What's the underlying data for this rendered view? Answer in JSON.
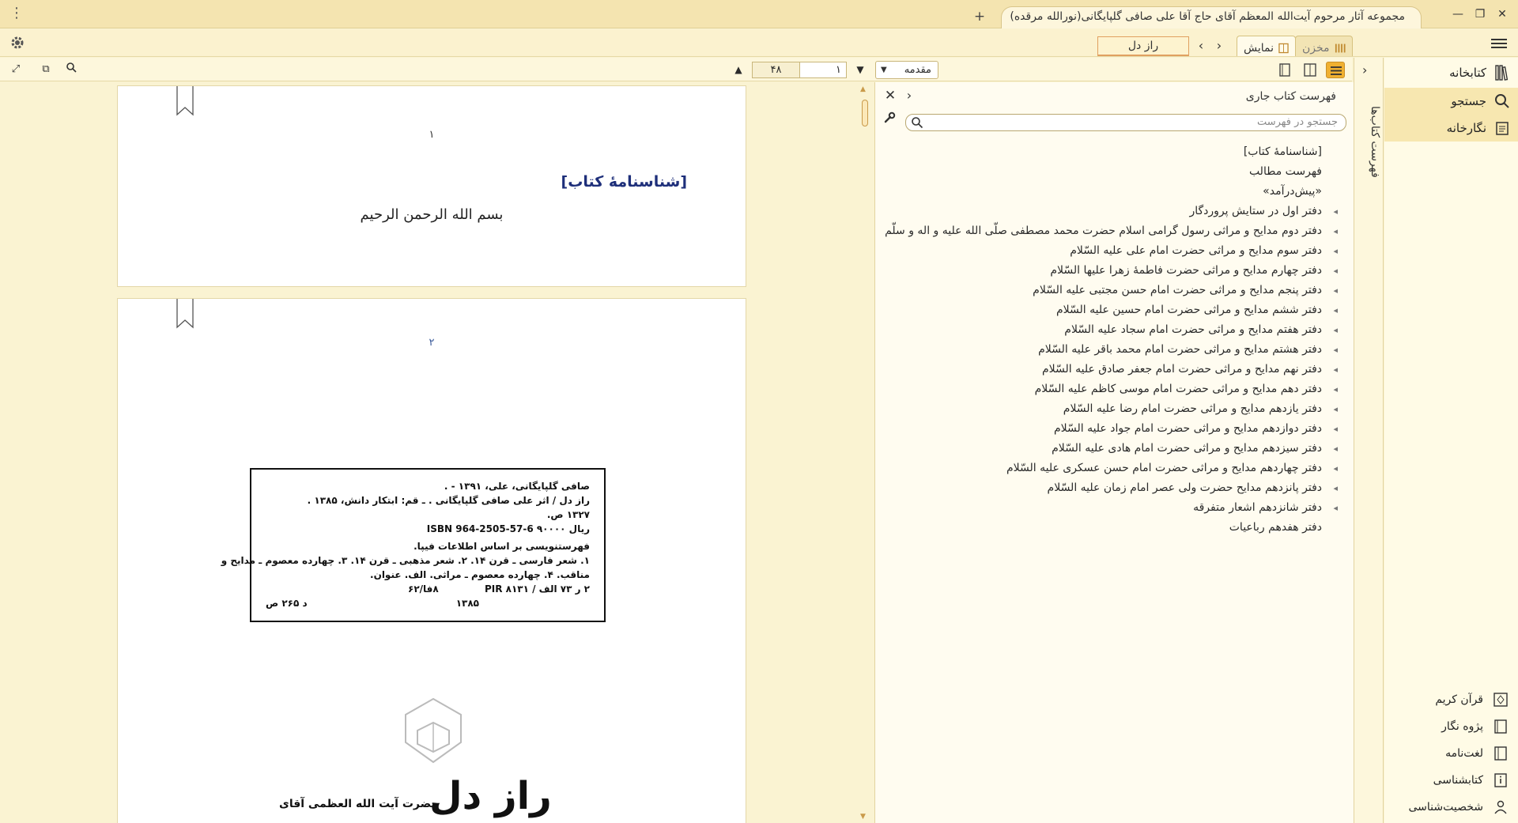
{
  "window": {
    "title": "مجموعه آثار مرحوم آیت‌الله المعظم آقای حاج آقا علی صافی گلپایگانی(نورالله مرقده)",
    "menu_dots": "⋮",
    "new_tab": "+",
    "minimize": "—",
    "restore": "❐",
    "close": "✕"
  },
  "top_tabs": {
    "makhzan": "مخزن",
    "namayesh": "نمایش",
    "book_tab": "راز دل"
  },
  "viewer_toolbar": {
    "section": "مقدمه",
    "page_current": "۱",
    "page_total": "۴۸"
  },
  "pages": {
    "page1": {
      "number": "۱",
      "heading": "[شناسنامهٔ کتاب]",
      "basmala": "بسم الله الرحمن الرحیم"
    },
    "page2": {
      "number": "۲",
      "catalog": {
        "line1": "صافی گلپایگانی، علی، ۱۳۹۱ - .",
        "line2": "راز دل / اثر علی صافی گلپایگانی . ـ قم: ابتکار دانش، ۱۳۸۵ .",
        "line3": "۱۳۲۷ ص.",
        "isbn": "ISBN 964-2505-57-6 ۹۰۰۰۰ ریال",
        "line5": "فهرستنویسی بر اساس اطلاعات فیپا.",
        "line6": "۱. شعر فارسی ـ قرن ۱۴. ۲. شعر مذهبی ـ قرن ۱۴. ۳. چهارده معصوم ـ مدایح و",
        "line7": "مناقب. ۴. چهارده معصوم ـ مراثی. الف. عنوان.",
        "line8_a": "۲ ر ۷۳ الف / ۸۱۳۱ PIR",
        "line8_b": "۸فا/۶۲",
        "line9_a": "۱۳۸۵",
        "line9_b": "د ۲۶۵ ص"
      },
      "bottom_text": "حضرت آیت الله العظمی آقای",
      "big_title": "راز دل"
    }
  },
  "toc": {
    "title": "فهرست کتاب جاری",
    "search_placeholder": "جستجو در فهرست",
    "items": [
      {
        "label": "[شناسنامهٔ کتاب]",
        "expandable": false
      },
      {
        "label": "فهرست مطالب",
        "expandable": false
      },
      {
        "label": "«پیش‌درآمد»",
        "expandable": false
      },
      {
        "label": "دفتر اول در ستایش پروردگار",
        "expandable": true
      },
      {
        "label": "دفتر دوم مدایح و مراثی رسول گرامی اسلام حضرت محمد مصطفی صلّی الله علیه و اله و سلّم",
        "expandable": true
      },
      {
        "label": "دفتر سوم مدایح و مراثی حضرت امام علی علیه السّلام",
        "expandable": true
      },
      {
        "label": "دفتر چهارم مدایح و مراثی حضرت فاطمهٔ زهرا علیها السّلام",
        "expandable": true
      },
      {
        "label": "دفتر پنجم مدایح و مراثی حضرت امام حسن مجتبی علیه السّلام",
        "expandable": true
      },
      {
        "label": "دفتر ششم مدایح و مراثی حضرت امام حسین علیه السّلام",
        "expandable": true
      },
      {
        "label": "دفتر هفتم مدایح و مراثی حضرت امام سجاد علیه السّلام",
        "expandable": true
      },
      {
        "label": "دفتر هشتم مدایح و مراثی حضرت امام محمد باقر علیه السّلام",
        "expandable": true
      },
      {
        "label": "دفتر نهم مدایح و مراثی حضرت امام جعفر صادق علیه السّلام",
        "expandable": true
      },
      {
        "label": "دفتر دهم مدایح و مراثی حضرت امام موسی کاظم علیه السّلام",
        "expandable": true
      },
      {
        "label": "دفتر یازدهم مدایح و مراثی حضرت امام رضا علیه السّلام",
        "expandable": true
      },
      {
        "label": "دفتر دوازدهم مدایح و مراثی حضرت امام جواد علیه السّلام",
        "expandable": true
      },
      {
        "label": "دفتر سیزدهم مدایح و مراثی حضرت امام هادی علیه السّلام",
        "expandable": true
      },
      {
        "label": "دفتر چهاردهم مدایح و مراثی حضرت امام حسن عسکری علیه السّلام",
        "expandable": true
      },
      {
        "label": "دفتر پانزدهم مدایح حضرت ولی عصر امام زمان علیه السّلام",
        "expandable": true
      },
      {
        "label": "دفتر شانزدهم اشعار متفرقه",
        "expandable": true
      },
      {
        "label": "دفتر هفدهم رباعیات",
        "expandable": false
      }
    ]
  },
  "side_tab": {
    "label": "فهرست کتاب‌ها"
  },
  "right_nav": {
    "library": "کتابخانه",
    "search": "جستجو",
    "gallery": "نگارخانه",
    "quran": "قرآن کریم",
    "pajouh": "پژوه نگار",
    "dictionary": "لغت‌نامه",
    "bibliography": "کتابشناسی",
    "biography": "شخصیت‌شناسی"
  },
  "colors": {
    "accent": "#f0b030",
    "heading_blue": "#1e2f7a",
    "selected_nav": "#f7e7b0",
    "background": "#faf3d2"
  }
}
